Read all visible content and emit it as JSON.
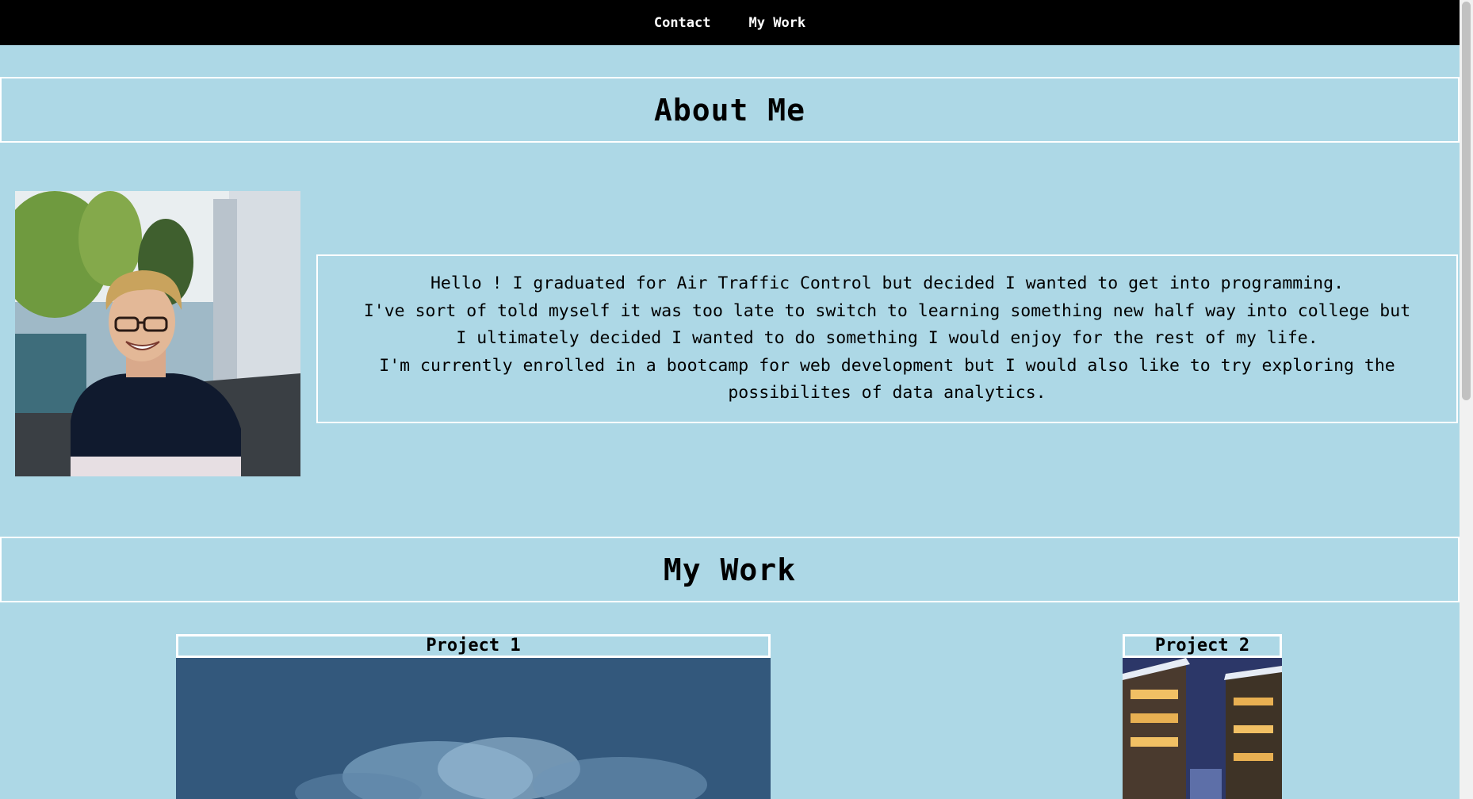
{
  "nav": {
    "links": [
      {
        "label": "Contact"
      },
      {
        "label": "My Work"
      }
    ]
  },
  "about": {
    "heading": "About Me",
    "bio": [
      "Hello ! I graduated for Air Traffic Control but decided I wanted to get into programming.",
      "I've sort of told myself it was too late to switch to learning something new half way into college but I ultimately decided I wanted to do something I would enjoy for the rest of my life.",
      "I'm currently enrolled in a bootcamp for web development but I would also like to try exploring the possibilites of data analytics."
    ]
  },
  "work": {
    "heading": "My Work",
    "projects": [
      {
        "title": "Project 1"
      },
      {
        "title": "Project 2"
      }
    ]
  },
  "colors": {
    "background": "#add8e6",
    "navbar": "#000000",
    "border": "#ffffff"
  }
}
